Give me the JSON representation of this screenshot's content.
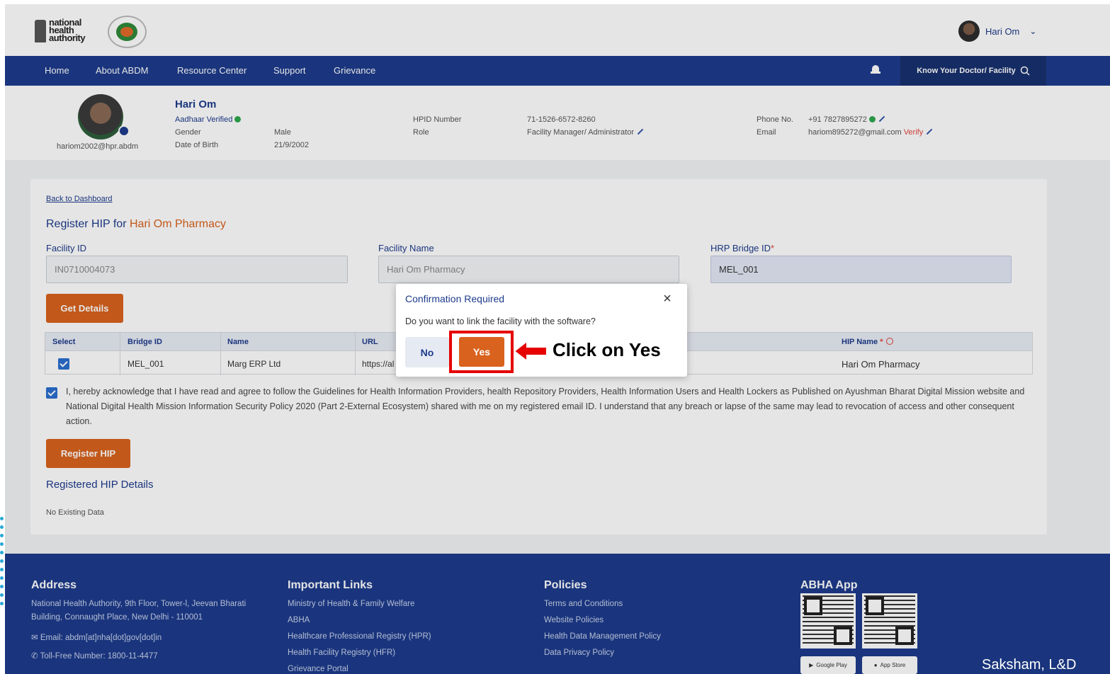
{
  "header": {
    "logo_text": "national health authority",
    "user_name": "Hari Om"
  },
  "nav": {
    "items": [
      "Home",
      "About ABDM",
      "Resource Center",
      "Support",
      "Grievance"
    ],
    "search_button": "Know Your Doctor/ Facility"
  },
  "profile": {
    "username": "hariom2002@hpr.abdm",
    "name": "Hari Om",
    "aadhaar_status": "Aadhaar Verified",
    "gender_label": "Gender",
    "gender": "Male",
    "dob_label": "Date of Birth",
    "dob": "21/9/2002",
    "hpid_label": "HPID Number",
    "hpid": "71-1526-6572-8260",
    "role_label": "Role",
    "role": "Facility Manager/ Administrator",
    "phone_label": "Phone No.",
    "phone": "+91 7827895272",
    "email_label": "Email",
    "email": "hariom895272@gmail.com",
    "verify": "Verify"
  },
  "form": {
    "back_link": "Back to Dashboard",
    "title_prefix": "Register HIP for",
    "facility_display": "Hari Om Pharmacy",
    "facility_id_label": "Facility ID",
    "facility_id": "IN0710004073",
    "facility_name_label": "Facility Name",
    "facility_name": "Hari Om Pharmacy",
    "bridge_id_label": "HRP Bridge ID",
    "bridge_id_required": "*",
    "bridge_id": "MEL_001",
    "get_details": "Get Details",
    "table": {
      "headers": [
        "Select",
        "Bridge ID",
        "Name",
        "URL",
        "HIP Name"
      ],
      "hip_required": "*",
      "row": {
        "bridge_id": "MEL_001",
        "name": "Marg ERP Ltd",
        "url": "https://al",
        "hip_name": "Hari Om Pharmacy"
      }
    },
    "acknowledgement": "I, hereby acknowledge that I have read and agree to follow the Guidelines for Health Information Providers, health Repository Providers, Health Information Users and Health Lockers as Published on Ayushman Bharat Digital Mission website and National Digital Health Mission Information Security Policy 2020 (Part 2-External Ecosystem) shared with me on my registered email ID. I understand that any breach or lapse of the same may lead to revocation of access and other consequent action.",
    "register_button": "Register HIP",
    "registered_title": "Registered HIP Details",
    "no_data": "No Existing Data"
  },
  "modal": {
    "title": "Confirmation Required",
    "question": "Do you want to link the facility with the software?",
    "no": "No",
    "yes": "Yes"
  },
  "callout": "Click on Yes",
  "footer": {
    "address_title": "Address",
    "address_line1": "National Health Authority, 9th Floor, Tower-l, Jeevan Bharati",
    "address_line2": "Building, Connaught Place, New Delhi - 110001",
    "email": "Email: abdm[at]nha[dot]gov[dot]in",
    "tollfree": "Toll-Free Number: 1800-11-4477",
    "links_title": "Important Links",
    "links": [
      "Ministry of Health & Family Welfare",
      "ABHA",
      "Healthcare Professional Registry (HPR)",
      "Health Facility Registry (HFR)",
      "Grievance Portal"
    ],
    "policies_title": "Policies",
    "policies": [
      "Terms and Conditions",
      "Website Policies",
      "Health Data Management Policy",
      "Data Privacy Policy"
    ],
    "app_title": "ABHA App",
    "google_play": "Google Play",
    "app_store": "App Store"
  },
  "watermark": "Saksham, L&D",
  "colors": {
    "primary": "#1d3b8c",
    "accent": "#d9621e",
    "highlight": "#e60000"
  }
}
